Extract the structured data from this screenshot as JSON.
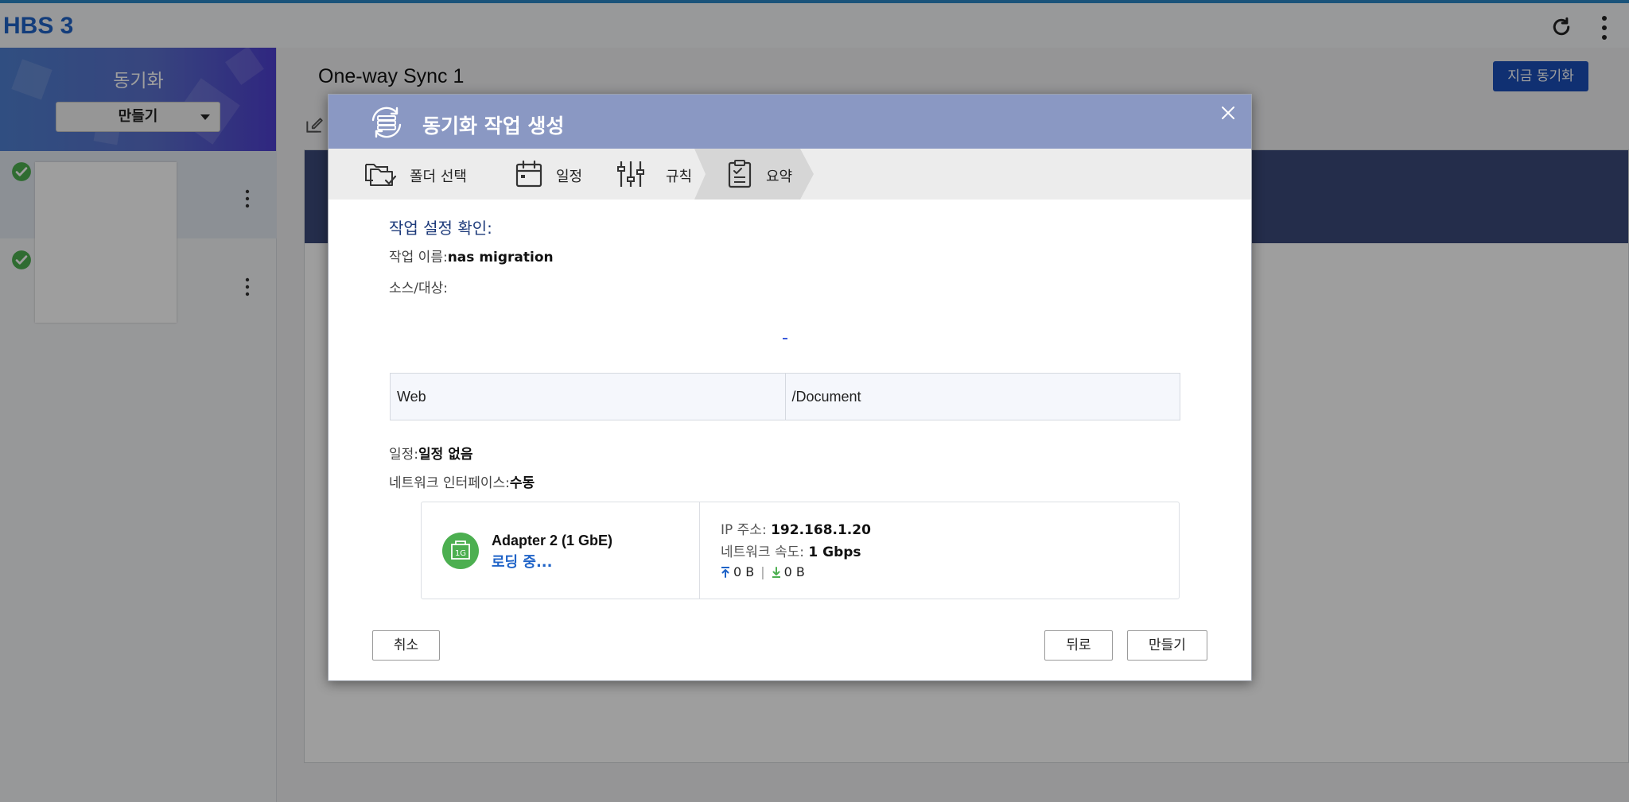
{
  "app": {
    "title": "HBS 3"
  },
  "sidebar": {
    "title": "동기화",
    "create_label": "만들기"
  },
  "main": {
    "job_title": "One-way Sync 1",
    "sync_now_label": "지금 동기화"
  },
  "dialog": {
    "title": "동기화 작업 생성",
    "steps": [
      {
        "label": "폴더 선택",
        "icon": "folder-select-icon"
      },
      {
        "label": "일정",
        "icon": "calendar-icon"
      },
      {
        "label": "규칙",
        "icon": "sliders-icon"
      },
      {
        "label": "요약",
        "icon": "clipboard-icon"
      }
    ],
    "active_step": "요약",
    "summary": {
      "heading": "작업 설정 확인:",
      "job_name_label": "작업 이름:",
      "job_name_value": "nas migration",
      "src_dst_label": "소스/대상:",
      "source": "Web",
      "destination": "/Document",
      "schedule_label": "일정:",
      "schedule_value": "일정 없음",
      "network_label": "네트워크 인터페이스:",
      "network_value": "수동"
    },
    "adapter": {
      "icon_text": "1G",
      "name": "Adapter 2 (1 GbE)",
      "status": "로딩 중...",
      "ip_label": "IP 주소:",
      "ip_value": "192.168.1.20",
      "speed_label": "네트워크 속도:",
      "speed_value": "1 Gbps",
      "upload": "0 B",
      "download": "0 B"
    },
    "buttons": {
      "cancel": "취소",
      "back": "뒤로",
      "create": "만들기"
    }
  },
  "colors": {
    "accent": "#1a4eb8",
    "header": "#8a98c3",
    "ok_green": "#4caf50"
  }
}
